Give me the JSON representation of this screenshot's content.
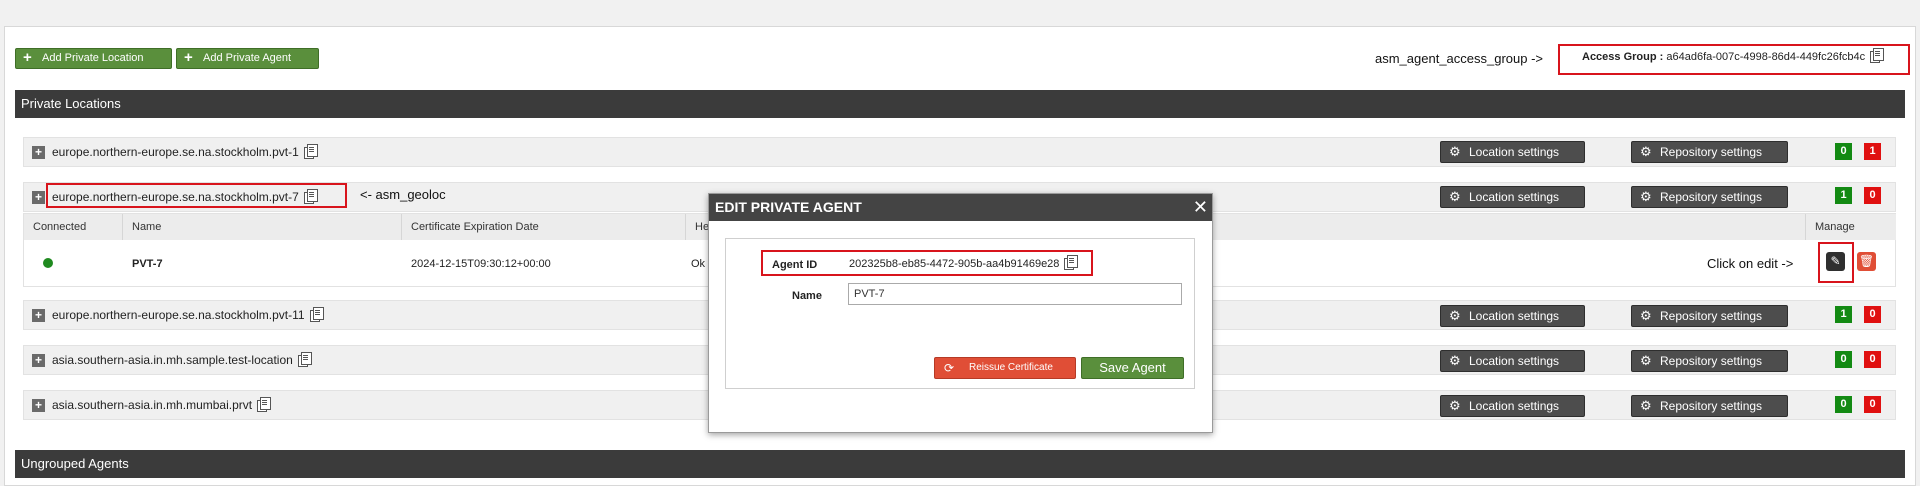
{
  "toolbar": {
    "add_location_label": "Add Private Location",
    "add_agent_label": "Add Private Agent"
  },
  "annotations": {
    "access_group_note": "asm_agent_access_group ->",
    "geoloc_note": "<- asm_geoloc",
    "edit_note": "Click on edit ->"
  },
  "access_group": {
    "label": "Access Group :",
    "value": "a64ad6fa-007c-4998-86d4-449fc26fcb4c"
  },
  "sections": {
    "private_locations": "Private Locations",
    "ungrouped_agents": "Ungrouped Agents"
  },
  "buttons": {
    "location_settings": "Location settings",
    "repository_settings": "Repository settings"
  },
  "locations": [
    {
      "name": "europe.northern-europe.se.na.stockholm.pvt-1",
      "green": "0",
      "red": "1"
    },
    {
      "name": "europe.northern-europe.se.na.stockholm.pvt-7",
      "green": "1",
      "red": "0"
    },
    {
      "name": "europe.northern-europe.se.na.stockholm.pvt-11",
      "green": "1",
      "red": "0"
    },
    {
      "name": "asia.southern-asia.in.mh.sample.test-location",
      "green": "0",
      "red": "0"
    },
    {
      "name": "asia.southern-asia.in.mh.mumbai.prvt",
      "green": "0",
      "red": "0"
    }
  ],
  "agents_table": {
    "headers": [
      "Connected",
      "Name",
      "Certificate Expiration Date",
      "Hea",
      "Manage"
    ],
    "rows": [
      {
        "name": "PVT-7",
        "cert_expiration": "2024-12-15T09:30:12+00:00",
        "health": "Ok"
      }
    ]
  },
  "dialog": {
    "title": "EDIT PRIVATE AGENT",
    "agent_id_label": "Agent ID",
    "agent_id_value": "202325b8-eb85-4472-905b-aa4b91469e28",
    "name_label": "Name",
    "name_value": "PVT-7",
    "reissue_label": "Reissue Certificate",
    "save_label": "Save Agent"
  },
  "colors": {
    "green_button": "#5a8f3c",
    "dark_button": "#4d4d4d",
    "badge_green": "#138a13",
    "badge_red": "#e01010",
    "highlight_red": "#d8141c"
  }
}
